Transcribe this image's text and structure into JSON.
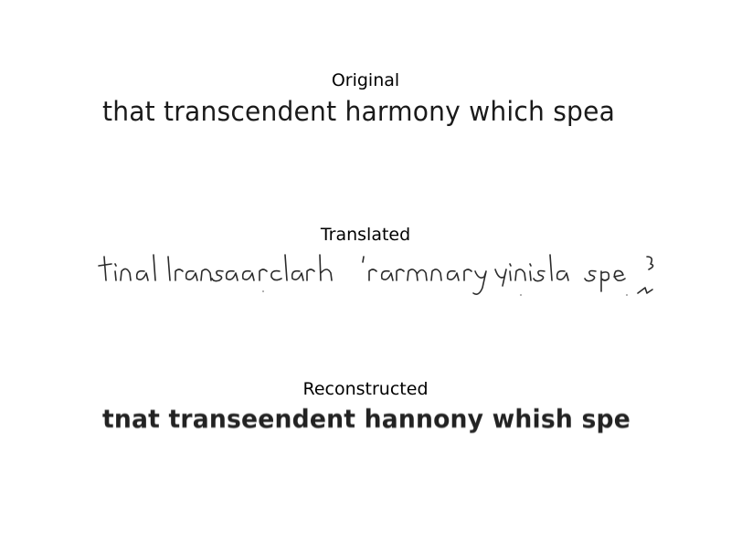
{
  "panels": [
    {
      "title": "Original",
      "content": "that transcendent harmony which spea"
    },
    {
      "title": "Translated",
      "content": "tinal lransaarclarh 'rarmnary yinisla spe"
    },
    {
      "title": "Reconstructed",
      "content": "tnat transeendent hannony whish spe"
    }
  ]
}
